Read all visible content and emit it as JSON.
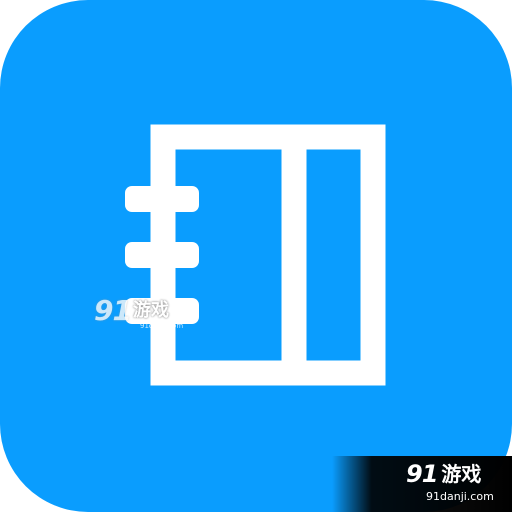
{
  "icon": {
    "name": "notebook-icon",
    "background_color": "#0A9DFE",
    "glyph_color": "#FFFFFF"
  },
  "watermark_center": {
    "logo": "91",
    "text": "游戏",
    "url": "91danji.com"
  },
  "watermark_corner": {
    "logo": "91",
    "text": "游戏",
    "url": "91danji.com",
    "background_color": "#000000"
  }
}
